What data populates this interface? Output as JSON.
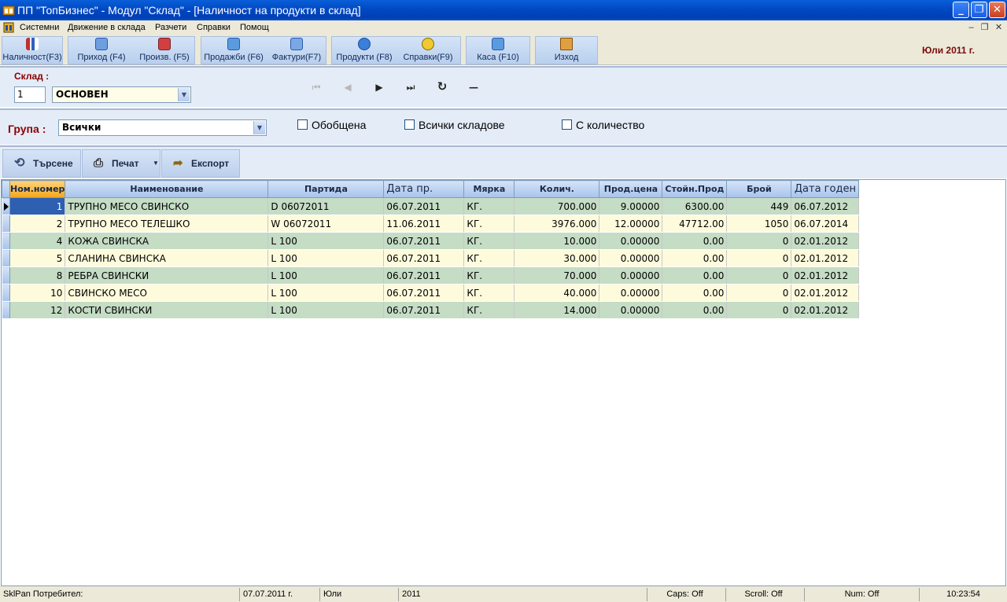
{
  "window": {
    "title": "ПП \"ТопБизнес\" - Модул \"Склад\" - [Наличност на продукти в склад]"
  },
  "menu": {
    "items": [
      "Системни",
      "Движение в склада",
      "Разчети",
      "Справки",
      "Помощ"
    ]
  },
  "toolbar": {
    "buttons": [
      {
        "label": "Наличност(F3)",
        "icon": "chart-icon"
      },
      {
        "label": "Приход (F4)",
        "icon": "document-icon"
      },
      {
        "label": "Произв. (F5)",
        "icon": "factory-icon"
      },
      {
        "label": "Продажби (F6)",
        "icon": "sales-icon"
      },
      {
        "label": "Фактури(F7)",
        "icon": "invoice-icon"
      },
      {
        "label": "Продукти (F8)",
        "icon": "products-icon"
      },
      {
        "label": "Справки(F9)",
        "icon": "reports-icon"
      },
      {
        "label": "Каса (F10)",
        "icon": "cash-icon"
      },
      {
        "label": "Изход",
        "icon": "exit-icon"
      }
    ],
    "date": "Юли  2011 г."
  },
  "warehouse": {
    "label": "Склад :",
    "code": "1",
    "name": "ОСНОВЕН"
  },
  "group": {
    "label": "Група :",
    "value": "Всички"
  },
  "options": {
    "summary": "Обобщена",
    "all_warehouses": "Всички складове",
    "with_quantity": "С количество"
  },
  "actions": {
    "search": "Търсене",
    "print": "Печат",
    "export": "Експорт"
  },
  "table": {
    "columns": [
      "Ном.номер",
      "Наименование",
      "Партида",
      "Дата пр.",
      "Мярка",
      "Колич.",
      "Прод.цена",
      "Стойн.Прод",
      "Брой",
      "Дата годен"
    ],
    "rows": [
      [
        "1",
        "ТРУПНО МЕСО СВИНСКО",
        "D 06072011",
        "06.07.2011",
        "КГ.",
        "700.000",
        "9.00000",
        "6300.00",
        "449",
        "06.07.2012"
      ],
      [
        "2",
        "ТРУПНО МЕСО ТЕЛЕШКО",
        "W 06072011",
        "11.06.2011",
        "КГ.",
        "3976.000",
        "12.00000",
        "47712.00",
        "1050",
        "06.07.2014"
      ],
      [
        "4",
        "КОЖА СВИНСКА",
        "L 100",
        "06.07.2011",
        "КГ.",
        "10.000",
        "0.00000",
        "0.00",
        "0",
        "02.01.2012"
      ],
      [
        "5",
        "СЛАНИНА  СВИНСКА",
        "L 100",
        "06.07.2011",
        "КГ.",
        "30.000",
        "0.00000",
        "0.00",
        "0",
        "02.01.2012"
      ],
      [
        "8",
        "РЕБРА СВИНСКИ",
        "L 100",
        "06.07.2011",
        "КГ.",
        "70.000",
        "0.00000",
        "0.00",
        "0",
        "02.01.2012"
      ],
      [
        "10",
        "СВИНСКО МЕСО",
        "L 100",
        "06.07.2011",
        "КГ.",
        "40.000",
        "0.00000",
        "0.00",
        "0",
        "02.01.2012"
      ],
      [
        "12",
        "КОСТИ СВИНСКИ",
        "L 100",
        "06.07.2011",
        "КГ.",
        "14.000",
        "0.00000",
        "0.00",
        "0",
        "02.01.2012"
      ]
    ]
  },
  "status": {
    "user": "SklPan Потребител:",
    "date": "07.07.2011 г.",
    "month": "Юли",
    "year": "2011",
    "caps": "Caps: Off",
    "scroll": "Scroll: Off",
    "num": "Num: Off",
    "time": "10:23:54"
  },
  "colors": {
    "title_bar": "#0049c4",
    "row_even": "#c5dcc5",
    "row_odd": "#fefbdd",
    "header_active": "#f2a81c",
    "label_red": "#8a0000"
  }
}
